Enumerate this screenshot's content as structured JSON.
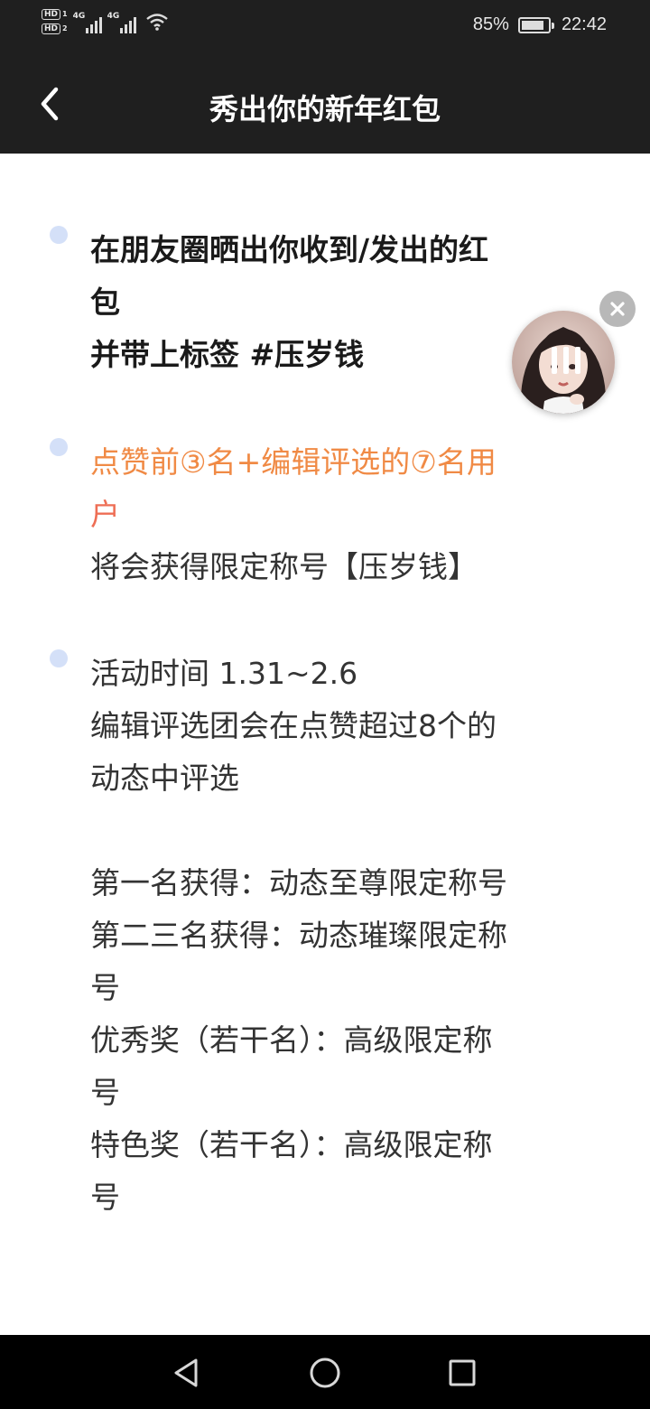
{
  "status_bar": {
    "hd_label_1": "HD",
    "hd_sub_1": "1",
    "hd_label_2": "HD",
    "hd_sub_2": "2",
    "network_1": "4G",
    "network_2": "4G",
    "battery_percent_text": "85%",
    "battery_level": 0.85,
    "time": "22:42"
  },
  "header": {
    "title": "秀出你的新年红包",
    "back_icon": "chevron-left-icon"
  },
  "content": {
    "section1": {
      "lines": [
        "在朋友圈晒出你收到/发出的红",
        "包",
        "并带上标签 #压岁钱"
      ]
    },
    "section2": {
      "highlight_line1": "点赞前③名+编辑评选的⑦名用",
      "highlight_line2": "户",
      "line3": "将会获得限定称号【压岁钱】"
    },
    "section3": {
      "lines": [
        "活动时间 1.31~2.6",
        "编辑评选团会在点赞超过8个的",
        "动态中评选",
        "",
        "第一名获得：动态至尊限定称号",
        "第二三名获得：动态璀璨限定称",
        "号",
        "优秀奖（若干名）：高级限定称",
        "号",
        "特色奖（若干名）：高级限定称",
        "号"
      ]
    }
  },
  "floating_widget": {
    "avatar_icon": "user-avatar",
    "close_icon": "close-icon",
    "pause_icon": "pause-icon"
  },
  "nav_bar": {
    "back_icon": "triangle-back-icon",
    "home_icon": "circle-home-icon",
    "recents_icon": "square-recents-icon"
  },
  "colors": {
    "bar_bg": "#1f1f1f",
    "bullet": "#d4e0f8",
    "highlight_orange": "#f08a45",
    "highlight_red": "#ee6e55"
  }
}
